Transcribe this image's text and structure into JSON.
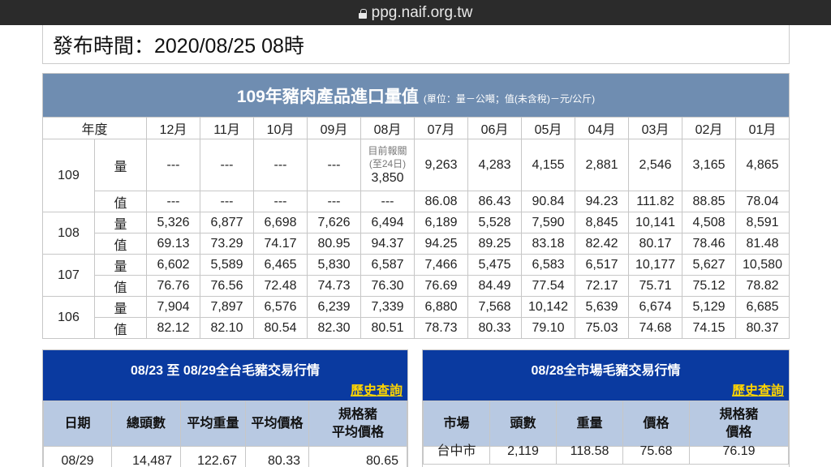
{
  "browser": {
    "url": "ppg.naif.org.tw"
  },
  "publish": {
    "text": "發布時間：2020/08/25 08時"
  },
  "import_table": {
    "title": "109年豬肉產品進口量值",
    "unit": "(單位：量－公噸；值(未含稅)－元/公斤)",
    "header_year": "年度",
    "months": [
      "12月",
      "11月",
      "10月",
      "09月",
      "08月",
      "07月",
      "06月",
      "05月",
      "04月",
      "03月",
      "02月",
      "01月"
    ],
    "rows": [
      {
        "year": "109",
        "qty_label": "量",
        "val_label": "值",
        "qty": [
          "---",
          "---",
          "---",
          "---",
          null,
          "9,263",
          "4,283",
          "4,155",
          "2,881",
          "2,546",
          "3,165",
          "4,865"
        ],
        "aug_note1": "目前報關",
        "aug_note2": "(至24日)",
        "aug_qty": "3,850",
        "val": [
          "---",
          "---",
          "---",
          "---",
          "---",
          "86.08",
          "86.43",
          "90.84",
          "94.23",
          "111.82",
          "88.85",
          "78.04"
        ]
      },
      {
        "year": "108",
        "qty_label": "量",
        "val_label": "值",
        "qty": [
          "5,326",
          "6,877",
          "6,698",
          "7,626",
          "6,494",
          "6,189",
          "5,528",
          "7,590",
          "8,845",
          "10,141",
          "4,508",
          "8,591"
        ],
        "val": [
          "69.13",
          "73.29",
          "74.17",
          "80.95",
          "94.37",
          "94.25",
          "89.25",
          "83.18",
          "82.42",
          "80.17",
          "78.46",
          "81.48"
        ]
      },
      {
        "year": "107",
        "qty_label": "量",
        "val_label": "值",
        "qty": [
          "6,602",
          "5,589",
          "6,465",
          "5,830",
          "6,587",
          "7,466",
          "5,475",
          "6,583",
          "6,517",
          "10,177",
          "5,627",
          "10,580"
        ],
        "val": [
          "76.76",
          "76.56",
          "72.48",
          "74.73",
          "76.30",
          "76.69",
          "84.49",
          "77.54",
          "72.17",
          "75.71",
          "75.12",
          "78.82"
        ]
      },
      {
        "year": "106",
        "qty_label": "量",
        "val_label": "值",
        "qty": [
          "7,904",
          "7,897",
          "6,576",
          "6,239",
          "7,339",
          "6,880",
          "7,568",
          "10,142",
          "5,639",
          "6,674",
          "5,129",
          "6,685"
        ],
        "val": [
          "82.12",
          "82.10",
          "80.54",
          "82.30",
          "80.51",
          "78.73",
          "80.33",
          "79.10",
          "75.03",
          "74.68",
          "74.15",
          "80.37"
        ]
      }
    ]
  },
  "weekly_panel": {
    "title": "08/23 至 08/29全台毛豬交易行情",
    "history_link": "歷史查詢",
    "headers": [
      "日期",
      "總頭數",
      "平均重量",
      "平均價格",
      "規格豬\n平均價格"
    ],
    "rows": [
      [
        "08/29",
        "14,487",
        "122.67",
        "80.33",
        "80.65"
      ]
    ]
  },
  "market_panel": {
    "title": "08/28全市場毛豬交易行情",
    "history_link": "歷史查詢",
    "headers": [
      "市場",
      "頭數",
      "重量",
      "價格",
      "規格豬\n價格"
    ],
    "rows": [
      [
        "台中市",
        "2,119",
        "118.58",
        "75.68",
        "76.19"
      ]
    ]
  }
}
